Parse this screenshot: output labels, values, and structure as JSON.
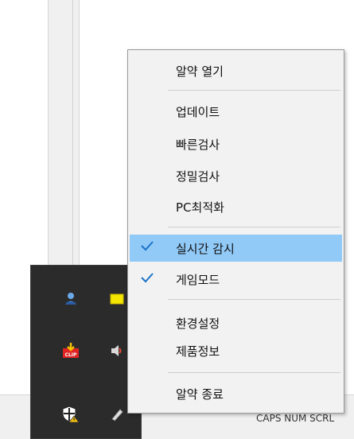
{
  "menu": {
    "items": [
      {
        "label": "알약 열기",
        "checked": false
      },
      {
        "label": "업데이트",
        "checked": false
      },
      {
        "label": "빠른검사",
        "checked": false
      },
      {
        "label": "정밀검사",
        "checked": false
      },
      {
        "label": "PC최적화",
        "checked": false
      },
      {
        "label": "실시간 감시",
        "checked": true
      },
      {
        "label": "게임모드",
        "checked": true
      },
      {
        "label": "환경설정",
        "checked": false
      },
      {
        "label": "제품정보",
        "checked": false
      },
      {
        "label": "알약 종료",
        "checked": false
      }
    ]
  },
  "status_bar": {
    "indicators": "CAPS  NUM  SCRL"
  },
  "tray": {
    "icons": [
      "network-user-icon",
      "sticky-note-icon",
      "clip-download-icon",
      "speaker-icon",
      "security-shield-warning-icon",
      "pen-tool-icon"
    ]
  },
  "colors": {
    "menu_bg": "#f2f2f2",
    "checked_highlight": "#91c9f7",
    "check_mark": "#1a73c8",
    "tray_bg": "#2b2b2b"
  }
}
